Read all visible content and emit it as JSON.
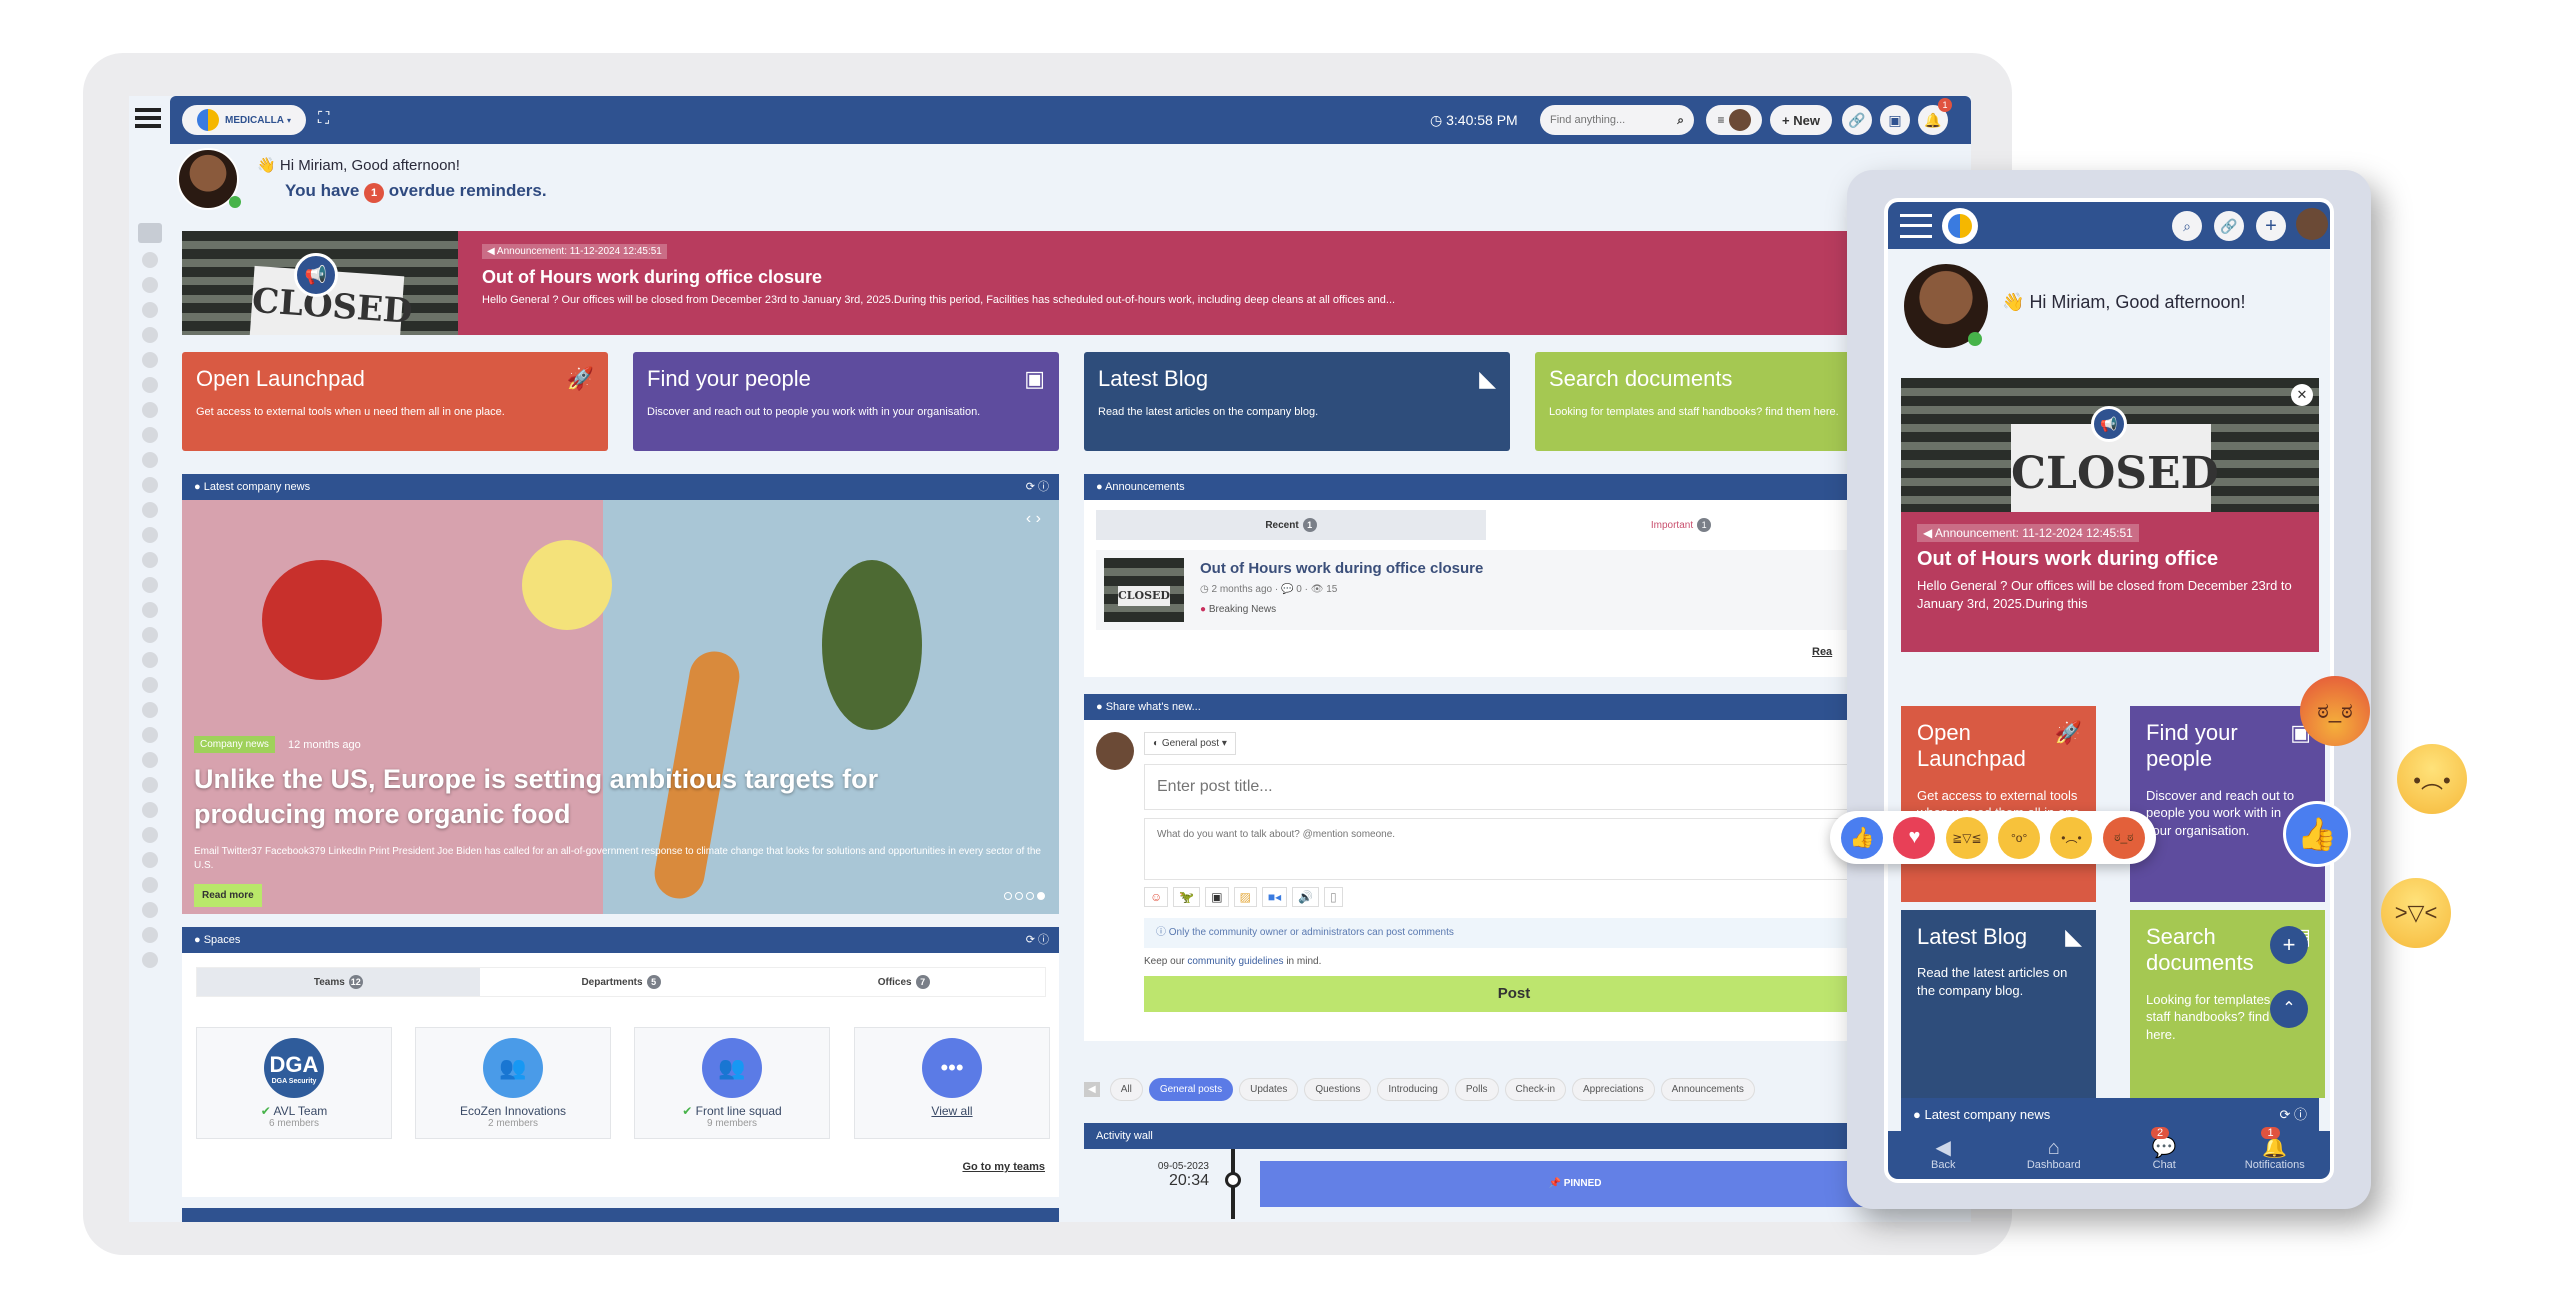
{
  "desktop": {
    "org_name": "MEDICALLA",
    "clock": "3:40:58 PM",
    "search_placeholder": "Find anything...",
    "new_label": "+ New",
    "notification_count": "1",
    "greeting": "Hi Miriam, Good afternoon!",
    "reminder_prefix": "You have",
    "reminder_count": "1",
    "reminder_suffix": "overdue reminders.",
    "sidebar_icons": [
      "home-icon",
      "eye-icon",
      "list-icon",
      "megaphone-icon",
      "search-icon",
      "folder-icon",
      "users-icon",
      "chat-icon",
      "calendar-icon",
      "share-icon",
      "video-icon",
      "comment-icon",
      "clock-icon",
      "rocket-icon",
      "grid-icon",
      "book-icon",
      "message-icon",
      "gear-icon",
      "list-icon",
      "help-icon",
      "network-icon",
      "archive-icon",
      "document-icon",
      "document-icon",
      "phone-icon",
      "settings-icon",
      "settings-icon",
      "info-icon",
      "plus-icon",
      "more-icon"
    ],
    "announcement": {
      "tag": "Announcement: 11-12-2024 12:45:51",
      "title": "Out of Hours work during office closure",
      "body": "Hello General ? Our offices will be closed from December 23rd to January 3rd, 2025.During this period, Facilities has scheduled out-of-hours work, including deep cleans at all offices and...",
      "sign_text": "CLOSED"
    },
    "tiles": [
      {
        "title": "Open Launchpad",
        "desc": "Get access to external tools when u need them all in one place.",
        "color": "#d95a43"
      },
      {
        "title": "Find your people",
        "desc": "Discover and reach out to people you work with in your organisation.",
        "color": "#5e4c9e"
      },
      {
        "title": "Latest Blog",
        "desc": "Read the latest articles on the company blog.",
        "color": "#2e4d7b"
      },
      {
        "title": "Search documents",
        "desc": "Looking for templates and staff handbooks? find them here.",
        "color": "#a5c852"
      }
    ],
    "news": {
      "header": "Latest company news",
      "category": "Company news",
      "age": "12 months ago",
      "headline": "Unlike the US, Europe is setting ambitious targets for producing more organic food",
      "excerpt": "Email Twitter37 Facebook379 LinkedIn Print President Joe Biden has called for an all-of-government response to climate change that looks for solutions and opportunities in every sector of the U.S.",
      "read_more": "Read more",
      "slides": 4,
      "active_slide": 4
    },
    "spaces": {
      "header": "Spaces",
      "tabs": [
        {
          "label": "Teams",
          "count": "12"
        },
        {
          "label": "Departments",
          "count": "5"
        },
        {
          "label": "Offices",
          "count": "7"
        }
      ],
      "cards": [
        {
          "name": "AVL Team",
          "members": "6 members",
          "logo": "DGA",
          "logo_sub": "DGA Security",
          "verified": true
        },
        {
          "name": "EcoZen Innovations",
          "members": "2 members"
        },
        {
          "name": "Front line squad",
          "members": "9 members",
          "verified": true
        },
        {
          "name": "View all"
        }
      ],
      "footer_link": "Go to my teams"
    },
    "announcements": {
      "header": "Announcements",
      "tabs": [
        {
          "label": "Recent",
          "count": "1"
        },
        {
          "label": "Important",
          "count": "1"
        }
      ],
      "item": {
        "title": "Out of Hours work during office closure",
        "age": "2 months ago",
        "comments": "0",
        "views": "15",
        "category": "Breaking News"
      },
      "read_link": "Rea"
    },
    "share": {
      "header": "Share what's new...",
      "post_type": "General post",
      "title_placeholder": "Enter post title...",
      "body_placeholder": "What do you want to talk about? @mention someone.",
      "notice": "Only the community owner or administrators can post comments",
      "guidelines_prefix": "Keep our",
      "guidelines_link": "community guidelines",
      "guidelines_suffix": "in mind.",
      "post_button": "Post"
    },
    "filters": [
      "All",
      "General posts",
      "Updates",
      "Questions",
      "Introducing",
      "Polls",
      "Check-in",
      "Appreciations",
      "Announcements"
    ],
    "active_filter": "General posts",
    "activity": {
      "header": "Activity wall",
      "date": "09-05-2023",
      "time": "20:34",
      "pinned": "PINNED"
    }
  },
  "mobile": {
    "greeting": "Hi Miriam, Good afternoon!",
    "announcement": {
      "tag": "Announcement: 11-12-2024 12:45:51",
      "title": "Out of Hours work during office",
      "body": "Hello General ? Our offices will be closed from December 23rd to January 3rd, 2025.During this",
      "sign_text": "CLOSED"
    },
    "tiles": [
      {
        "title": "Open Launchpad",
        "desc": "Get access to external tools when u need them all in one place.",
        "color": "#d95a43"
      },
      {
        "title": "Find your people",
        "desc": "Discover and reach out to people you work with in your organisation.",
        "color": "#5e4c9e"
      },
      {
        "title": "Latest Blog",
        "desc": "Read the latest articles on the company blog.",
        "color": "#2e4d7b"
      },
      {
        "title": "Search documents",
        "desc": "Looking for templates and staff handbooks? find them here.",
        "color": "#a5c852"
      }
    ],
    "news_header": "Latest company news",
    "nav": [
      {
        "label": "Back"
      },
      {
        "label": "Dashboard"
      },
      {
        "label": "Chat",
        "badge": "2"
      },
      {
        "label": "Notifications",
        "badge": "1"
      }
    ]
  },
  "reactions": [
    "like",
    "love",
    "haha",
    "wow",
    "sad",
    "angry"
  ]
}
